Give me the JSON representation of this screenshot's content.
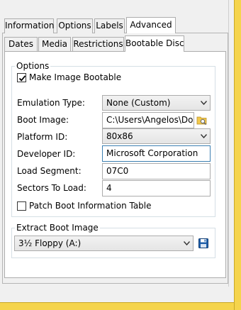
{
  "outer_tabs": [
    {
      "label": "Information"
    },
    {
      "label": "Options"
    },
    {
      "label": "Labels"
    },
    {
      "label": "Advanced"
    }
  ],
  "inner_tabs": [
    {
      "label": "Dates"
    },
    {
      "label": "Media"
    },
    {
      "label": "Restrictions"
    },
    {
      "label": "Bootable Disc"
    }
  ],
  "options_group": {
    "legend": "Options",
    "make_bootable": {
      "label": "Make Image Bootable",
      "checked": true
    },
    "fields": {
      "emulation_type": {
        "label": "Emulation Type:",
        "value": "None (Custom)"
      },
      "boot_image": {
        "label": "Boot Image:",
        "value": "C:\\Users\\Angelos\\Dow"
      },
      "platform_id": {
        "label": "Platform ID:",
        "value": "80x86"
      },
      "developer_id": {
        "label": "Developer ID:",
        "value": "Microsoft Corporation"
      },
      "load_segment": {
        "label": "Load Segment:",
        "value": "07C0"
      },
      "sectors_to_load": {
        "label": "Sectors To Load:",
        "value": "4"
      }
    },
    "patch_boot_table": {
      "label": "Patch Boot Information Table",
      "checked": false
    }
  },
  "extract_group": {
    "legend": "Extract Boot Image",
    "drive_value": "3½ Floppy (A:)"
  },
  "icons": {
    "browse": "folder-search-icon",
    "save": "floppy-save-icon"
  },
  "colors": {
    "frame_accent": "#f5d44c",
    "focus_border": "#3c7fb1",
    "save_icon": "#1f5faa"
  }
}
